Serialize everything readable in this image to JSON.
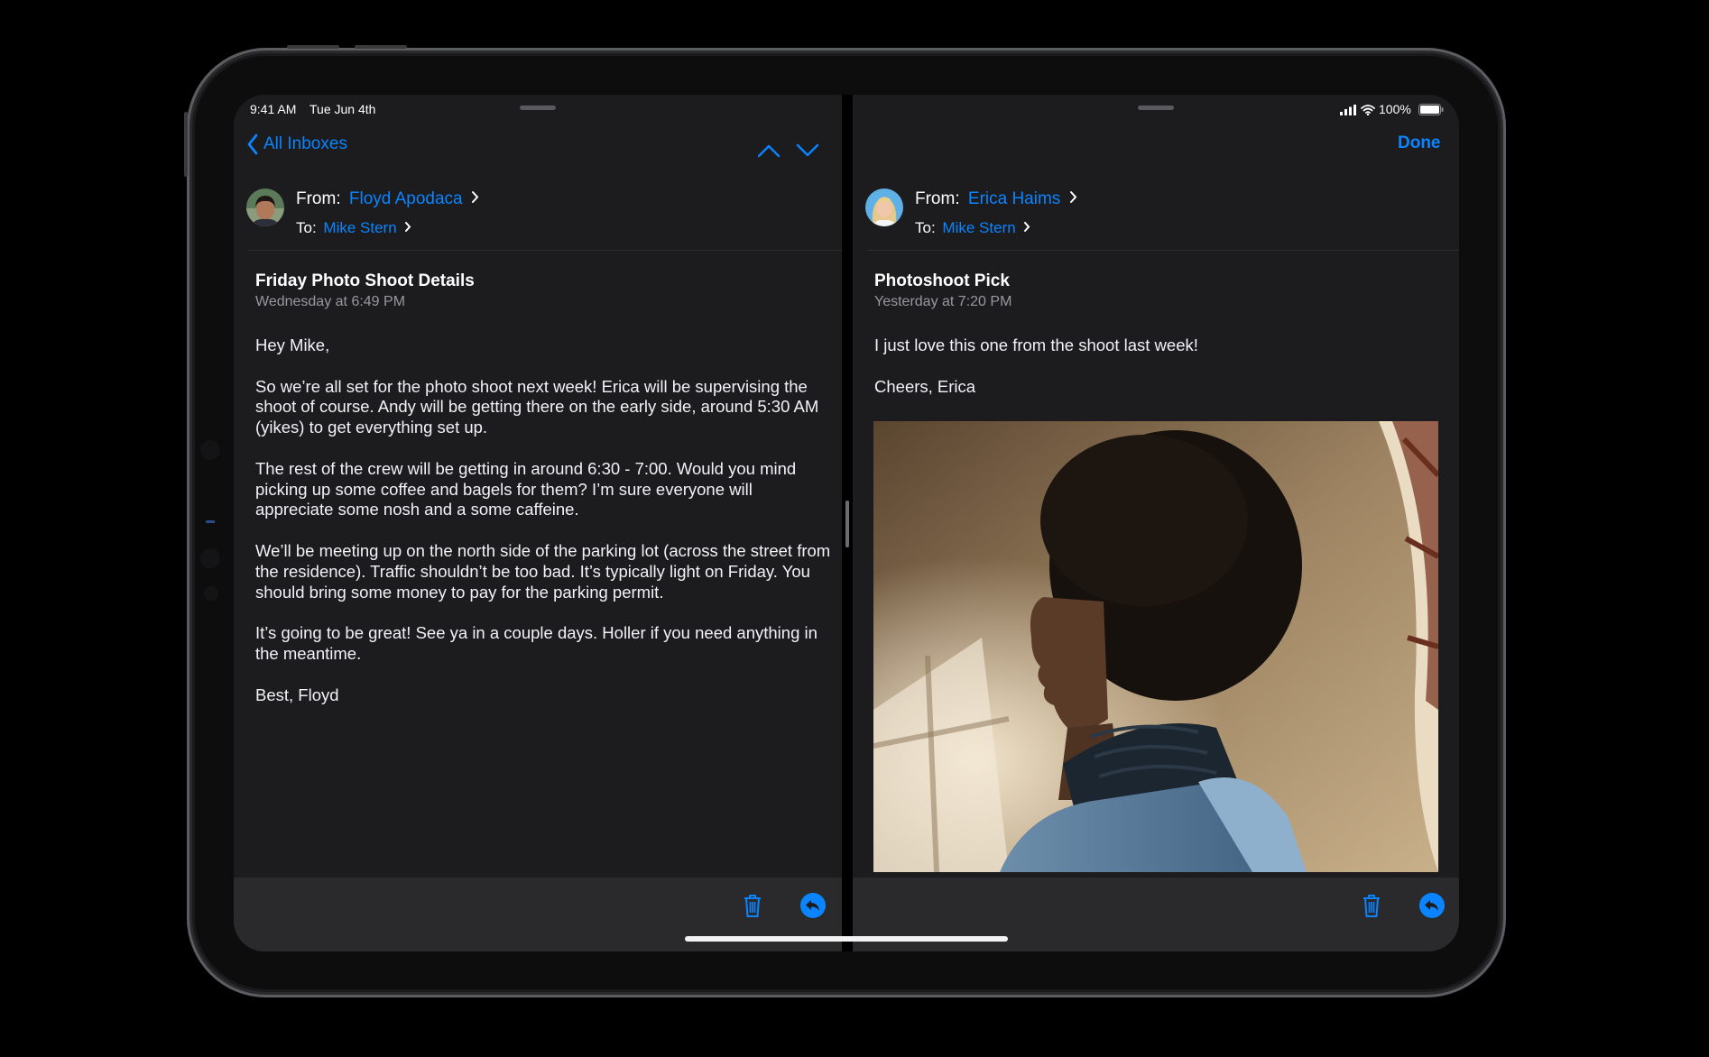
{
  "status_bar": {
    "time": "9:41 AM",
    "date": "Tue Jun 4th",
    "battery": "100%"
  },
  "left_pane": {
    "nav": {
      "back_label": "All Inboxes"
    },
    "from_label": "From:",
    "from_name": "Floyd Apodaca",
    "to_label": "To:",
    "to_name": "Mike Stern",
    "subject": "Friday Photo Shoot Details",
    "date": "Wednesday at 6:49 PM",
    "body": [
      "Hey Mike,",
      "So we’re all set for the photo shoot next week! Erica will be supervising the shoot of course. Andy will be getting there on the early side, around 5:30 AM (yikes) to get everything set up.",
      "The rest of the crew will be getting in around 6:30 - 7:00. Would you mind picking up some coffee and bagels for them? I’m sure everyone will appreciate some nosh and a some caffeine.",
      "We’ll be meeting up on the north side of the parking lot (across the street from the residence). Traffic shouldn’t be too bad. It’s typically light on Friday. You should bring some money to pay for the parking permit.",
      "It’s going to be great! See ya in a couple days. Holler if you need anything in the meantime.",
      "Best, Floyd"
    ]
  },
  "right_pane": {
    "nav": {
      "done_label": "Done"
    },
    "from_label": "From:",
    "from_name": "Erica Haims",
    "to_label": "To:",
    "to_name": "Mike Stern",
    "subject": "Photoshoot Pick",
    "date": "Yesterday at 7:20 PM",
    "body": [
      "I just love this one from the shoot last week!",
      "Cheers, Erica"
    ]
  },
  "colors": {
    "accent": "#0a84ff",
    "background": "#1c1c1e",
    "toolbar": "#2a2a2d",
    "secondary_text": "#98989d"
  },
  "icons": {
    "back": "chevron-left-icon",
    "prev": "chevron-up-icon",
    "next": "chevron-down-icon",
    "trash": "trash-icon",
    "reply": "reply-icon",
    "signal": "cellular-signal-icon",
    "wifi": "wifi-icon",
    "battery": "battery-icon"
  }
}
